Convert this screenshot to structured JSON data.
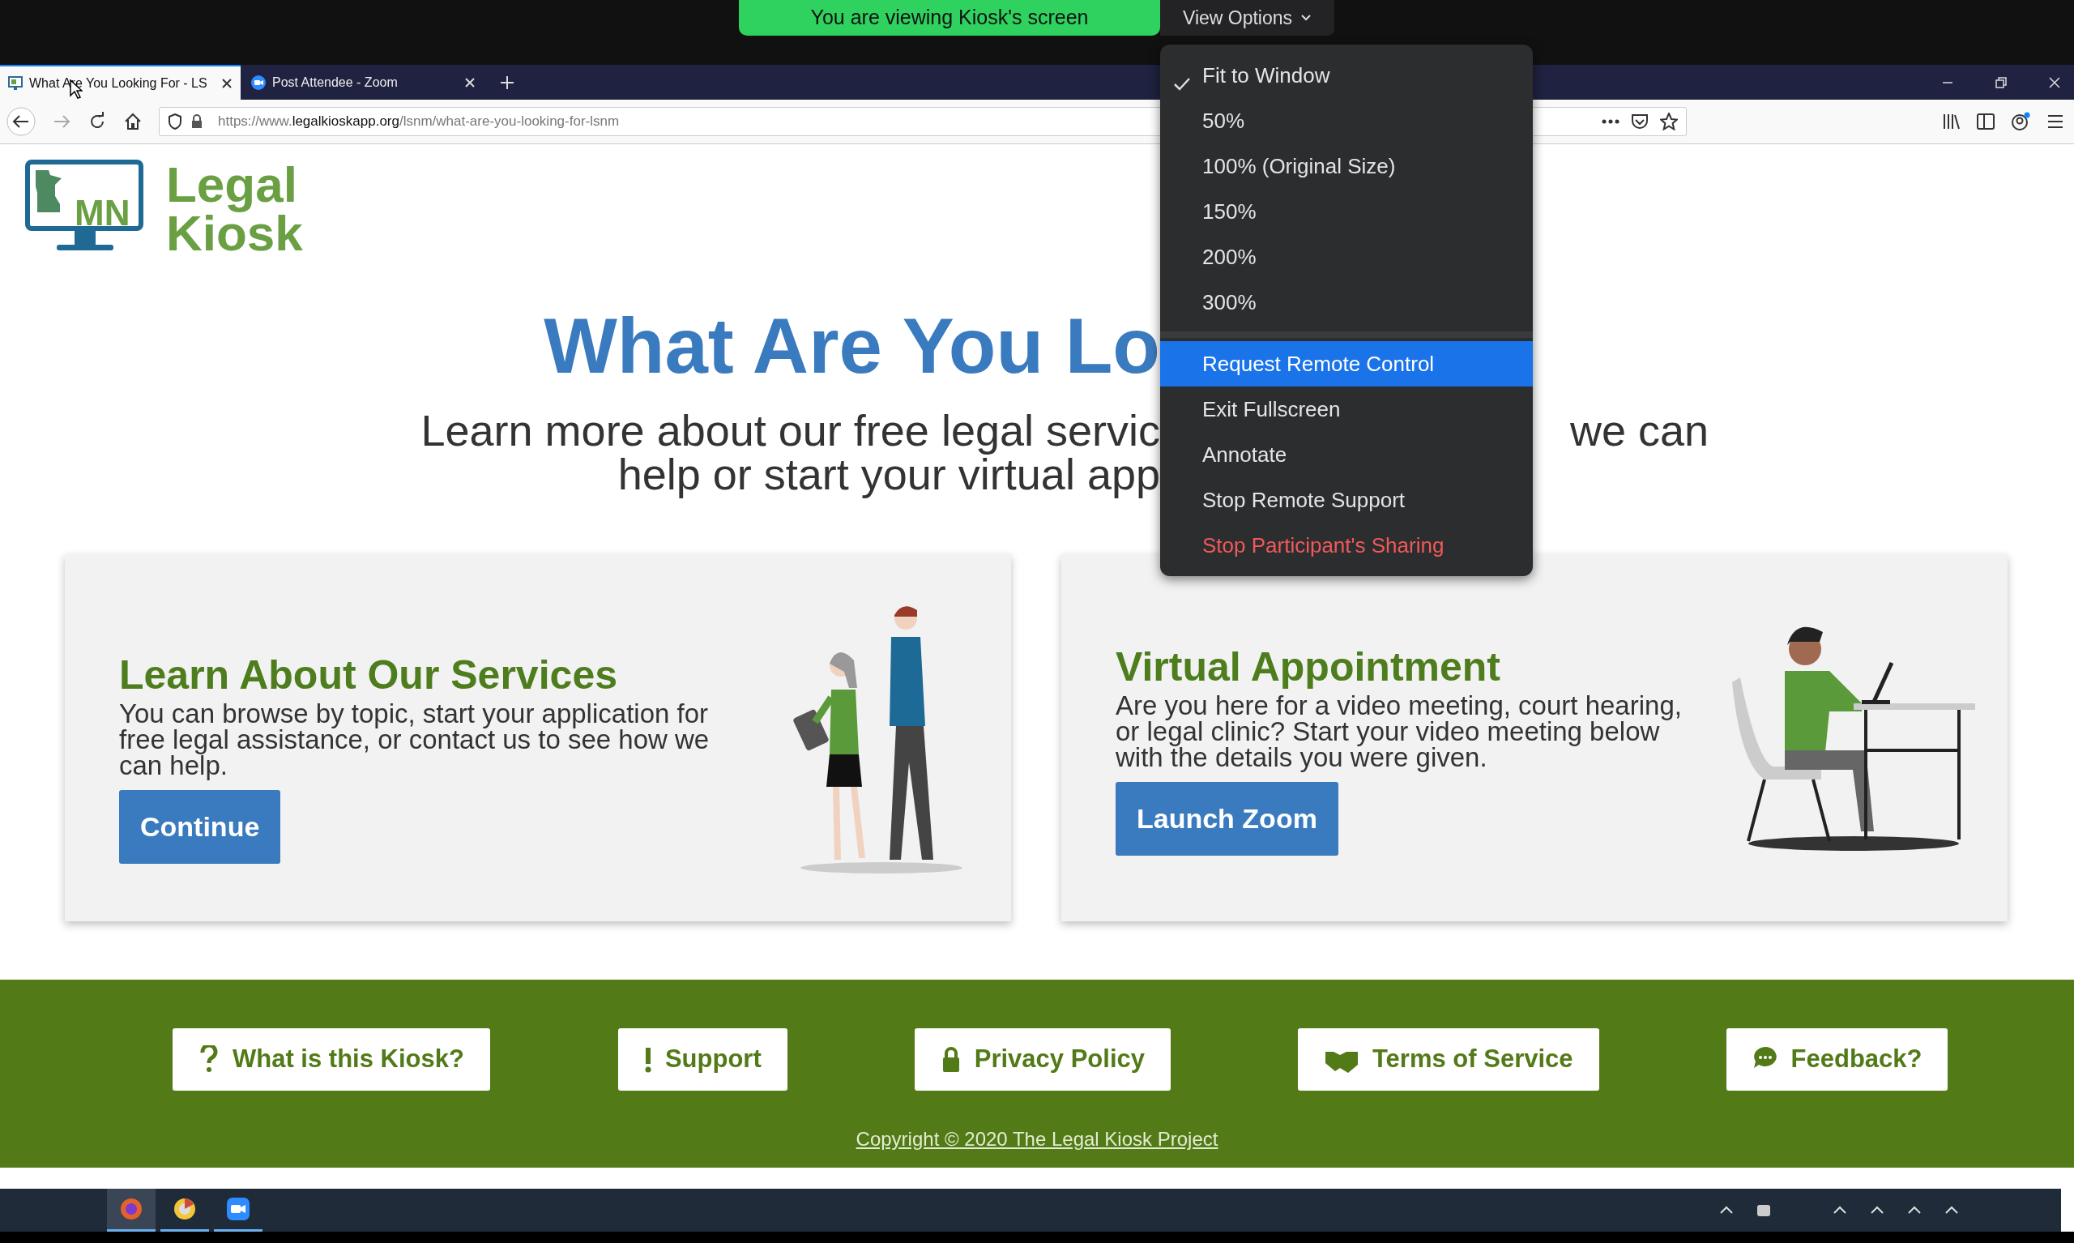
{
  "zoom_bar": {
    "banner": "You are viewing Kiosk's screen",
    "view_options": "View Options"
  },
  "view_menu": {
    "items": [
      {
        "label": "Fit to Window",
        "kind": "level",
        "checked": true,
        "selected": false
      },
      {
        "label": "50%",
        "kind": "level",
        "checked": false,
        "selected": false
      },
      {
        "label": "100% (Original Size)",
        "kind": "level",
        "checked": false,
        "selected": false
      },
      {
        "label": "150%",
        "kind": "level",
        "checked": false,
        "selected": false
      },
      {
        "label": "200%",
        "kind": "level",
        "checked": false,
        "selected": false
      },
      {
        "label": "300%",
        "kind": "level",
        "checked": false,
        "selected": false
      },
      {
        "label": "Request Remote Control",
        "kind": "action",
        "checked": false,
        "selected": true
      },
      {
        "label": "Exit Fullscreen",
        "kind": "action",
        "checked": false,
        "selected": false
      },
      {
        "label": "Annotate",
        "kind": "action",
        "checked": false,
        "selected": false
      },
      {
        "label": "Stop Remote Support",
        "kind": "action",
        "checked": false,
        "selected": false
      },
      {
        "label": "Stop Participant's Sharing",
        "kind": "danger",
        "checked": false,
        "selected": false
      }
    ]
  },
  "browser": {
    "tabs": [
      {
        "title": "What Are You Looking For - LS",
        "selected": true
      },
      {
        "title": "Post Attendee - Zoom",
        "selected": false
      }
    ],
    "url": {
      "prefix": "https://www.",
      "domain": "legalkioskapp.org",
      "path": "/lsnm/what-are-you-looking-for-lsnm"
    }
  },
  "site": {
    "logo": {
      "badge": "MN",
      "line1": "Legal",
      "line2": "Kiosk"
    },
    "heading": "What Are You Lo",
    "subtitle": {
      "line1_left": "Learn more about our free legal servic",
      "line1_right": "we can",
      "line2": "help or start your virtual app"
    },
    "cards": [
      {
        "title": "Learn About Our Services",
        "text": "You can browse by topic, start your application for free legal assistance, or contact us to see how we can help.",
        "button": "Continue"
      },
      {
        "title": "Virtual Appointment",
        "text": "Are you here for a video meeting, court hearing, or legal clinic? Start your video meeting below with the details you were given.",
        "button": "Launch Zoom"
      }
    ],
    "footer_links": [
      {
        "label": "What is this Kiosk?"
      },
      {
        "label": "Support"
      },
      {
        "label": "Privacy Policy"
      },
      {
        "label": "Terms of Service"
      },
      {
        "label": "Feedback?"
      }
    ],
    "copyright": "Copyright © 2020 The Legal Kiosk Project"
  }
}
